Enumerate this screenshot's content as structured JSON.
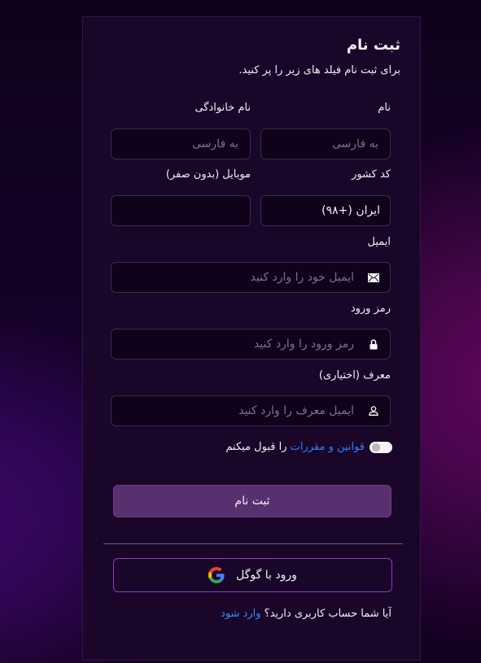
{
  "form": {
    "title": "ثبت نام",
    "subtitle": "برای ثبت نام فیلد های زیر را پر کنید.",
    "fields": {
      "first_name": {
        "label": "نام",
        "placeholder": "به فارسی",
        "value": ""
      },
      "last_name": {
        "label": "نام خانوادگی",
        "placeholder": "به فارسی",
        "value": ""
      },
      "country_code": {
        "label": "کد کشور",
        "value": "ایران (+۹۸)"
      },
      "mobile": {
        "label": "موبایل (بدون صفر)",
        "placeholder": "",
        "value": ""
      },
      "email": {
        "label": "ایمیل",
        "placeholder": "ایمیل خود را وارد کنید",
        "value": "",
        "icon": "envelope-icon"
      },
      "password": {
        "label": "رمز ورود",
        "placeholder": "رمز ورود را وارد کنید",
        "value": "",
        "icon": "lock-icon"
      },
      "referrer": {
        "label": "معرف (اختیاری)",
        "placeholder": "ایمیل معرف را وارد کنید",
        "value": "",
        "icon": "user-icon"
      }
    },
    "terms": {
      "link_text": "قوانین و مقررات",
      "suffix_text": " را قبول میکنم",
      "accepted": false
    },
    "submit_label": "ثبت نام",
    "google_label": "ورود با گوگل",
    "footer": {
      "question": "آیا شما حساب کاربری دارید؟ ",
      "login_link": "وارد شود"
    }
  },
  "colors": {
    "accent_button": "#58306f",
    "google_border": "#8a3fbf",
    "link": "#2f7ff5",
    "card_bg": "#1a0629"
  }
}
